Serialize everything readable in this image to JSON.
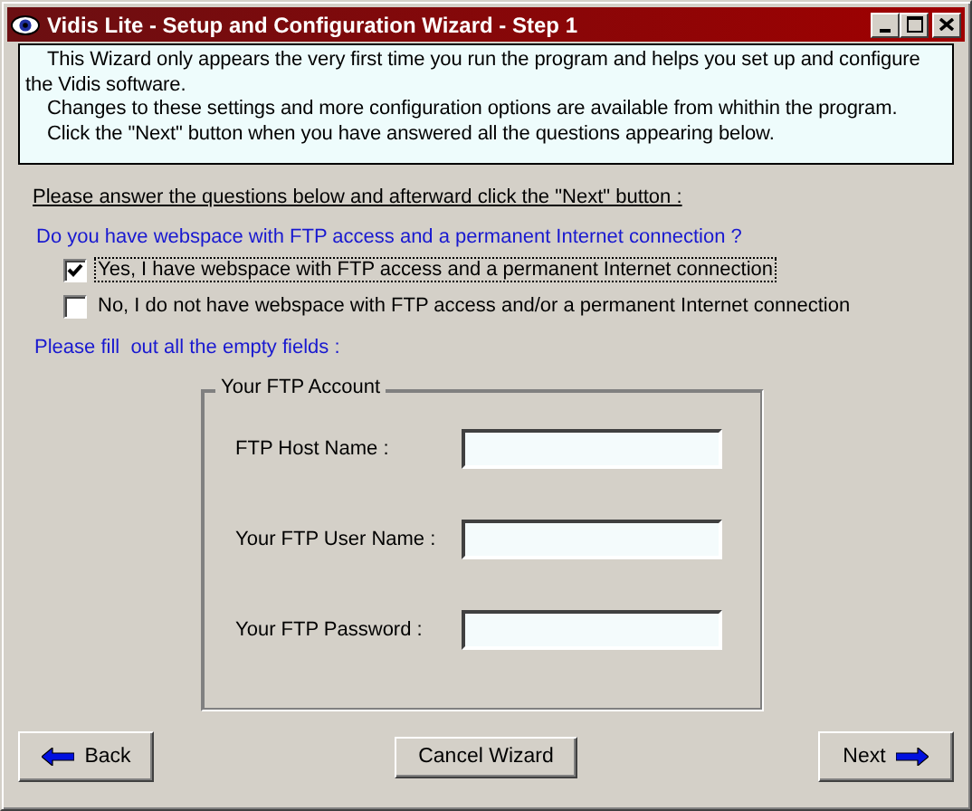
{
  "window": {
    "title": "Vidis Lite - Setup and Configuration Wizard - Step 1"
  },
  "intro": [
    "This Wizard only appears the very first time you run the program and helps you set up and configure the Vidis software.",
    "Changes to these settings and more configuration options are available from whithin the program.",
    "Click the \"Next\" button when you have answered all the questions appearing below."
  ],
  "instruction": "Please answer the questions below and afterward click the \"Next\" button :",
  "question": "Do you have webspace with FTP access and a permanent Internet connection ?",
  "options": [
    {
      "label": "Yes, I have webspace with FTP access and a permanent Internet connection",
      "checked": true,
      "focused": true
    },
    {
      "label": "No, I do not have webspace with FTP access and/or a permanent Internet connection",
      "checked": false,
      "focused": false
    }
  ],
  "fields_prompt": "Please fill  out all the empty fields :",
  "ftp_account": {
    "title": "Your FTP Account",
    "fields": [
      {
        "label": "FTP Host Name :"
      },
      {
        "label": "Your FTP User Name :"
      },
      {
        "label": "Your FTP Password :"
      }
    ]
  },
  "buttons": [
    {
      "label": "Back",
      "kind": "back"
    },
    {
      "label": "Cancel Wizard",
      "kind": "cancel"
    },
    {
      "label": "Next",
      "kind": "next"
    }
  ]
}
